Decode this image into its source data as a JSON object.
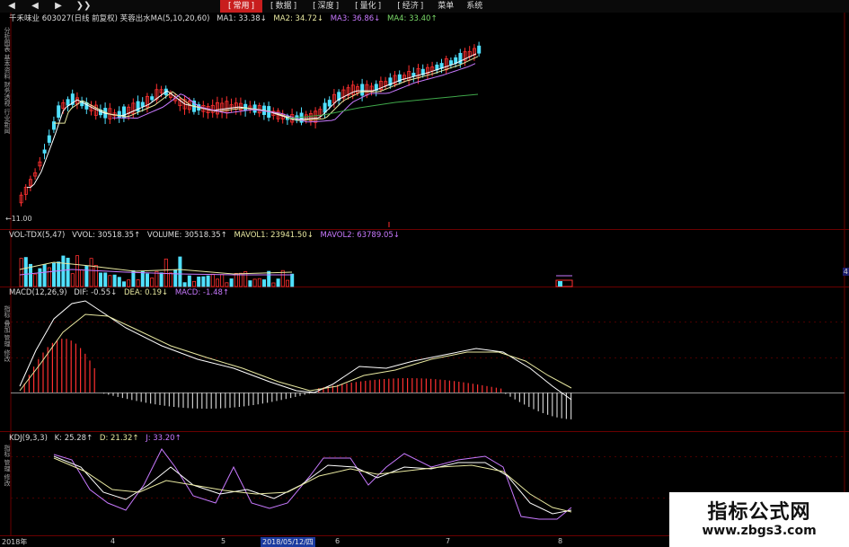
{
  "toolbar": {
    "nav": [
      "◀",
      "◀",
      "▶",
      "❯❯"
    ],
    "tabs": [
      {
        "label": "常用",
        "active": true,
        "bracket": true
      },
      {
        "label": "数据",
        "active": false,
        "bracket": true
      },
      {
        "label": "深度",
        "active": false,
        "bracket": true
      },
      {
        "label": "量化",
        "active": false,
        "bracket": true
      },
      {
        "label": "经济",
        "active": false,
        "bracket": true
      },
      {
        "label": "菜单",
        "active": false,
        "bracket": false
      },
      {
        "label": "系统",
        "active": false,
        "bracket": false
      }
    ]
  },
  "main_info": {
    "title": "千禾味业 603027(日线 前复权) 芙蓉出水MA(5,10,20,60)",
    "ma1": "MA1: 33.38↓",
    "ma2": "MA2: 34.72↓",
    "ma3": "MA3: 36.86↓",
    "ma4": "MA4: 33.40↑"
  },
  "vol_info": {
    "name": "VOL-TDX(5,47)",
    "vvol": "VVOL: 30518.35↑",
    "volume": "VOLUME: 30518.35↑",
    "mavol1": "MAVOL1: 23941.50↓",
    "mavol2": "MAVOL2: 63789.05↓"
  },
  "macd_info": {
    "name": "MACD(12,26,9)",
    "dif": "DIF: -0.55↓",
    "dea": "DEA: 0.19↓",
    "macd": "MACD: -1.48↑"
  },
  "kdj_info": {
    "name": "KDJ(9,3,3)",
    "k": "K: 25.28↑",
    "d": "D: 21.32↑",
    "j": "J: 33.20↑"
  },
  "side_labels": {
    "main": "分析图表 基本资料 财务透视 行业新闻",
    "macd": "指标 叠加 管理 修改",
    "kdj": "指标 管理 修改"
  },
  "price_label": "←11.00",
  "x_axis": {
    "year": "2018年",
    "m4": "4",
    "m5": "5",
    "date": "2018/05/12/四",
    "m6": "6",
    "m7": "7",
    "m8": "8"
  },
  "right_label": "4",
  "watermark": {
    "line1": "指标公式网",
    "line2": "www.zbgs3.com"
  },
  "colors": {
    "up": "#ff3030",
    "down": "#50e0ff",
    "ma1": "#ffffff",
    "ma2": "#e8e8a0",
    "ma3": "#c879ff",
    "ma4": "#3fa84a",
    "grid": "#6a0000"
  }
}
